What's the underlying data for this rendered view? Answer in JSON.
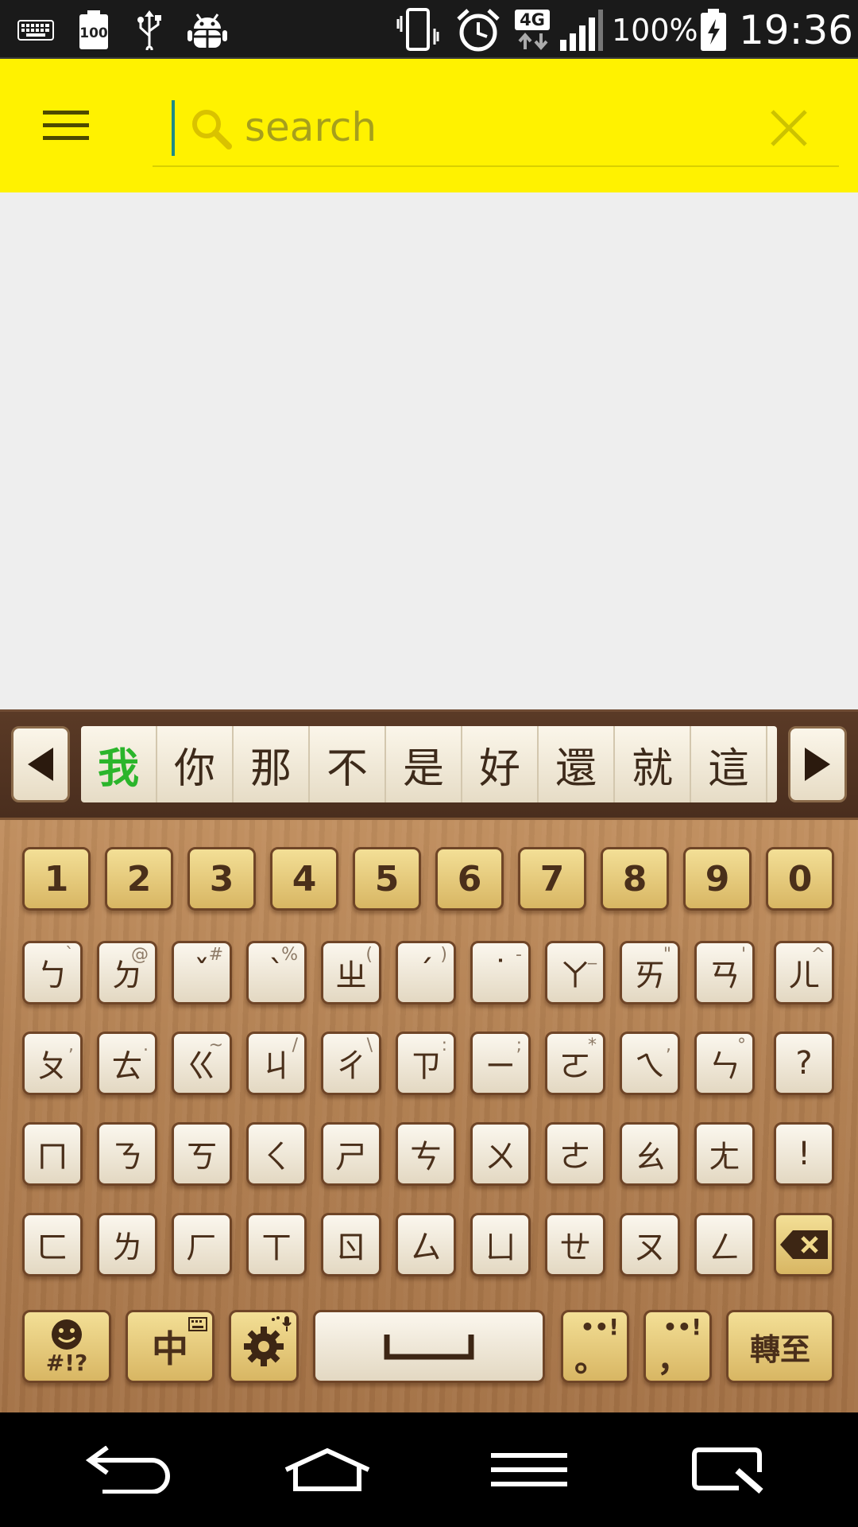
{
  "status_bar": {
    "battery_box_label": "100",
    "network_type": "4G",
    "battery_percent": "100%",
    "time": "19:36",
    "icons": [
      "keyboard-icon",
      "battery-100-icon",
      "usb-icon",
      "android-debug-icon",
      "vibrate-icon",
      "alarm-icon",
      "network-4g-icon",
      "signal-icon",
      "battery-charging-icon"
    ]
  },
  "app_bar": {
    "search_placeholder": "search",
    "search_value": ""
  },
  "candidates": [
    "我",
    "你",
    "那",
    "不",
    "是",
    "好",
    "還",
    "就",
    "這"
  ],
  "keyboard": {
    "number_row": [
      "1",
      "2",
      "3",
      "4",
      "5",
      "6",
      "7",
      "8",
      "9",
      "0"
    ],
    "row1": [
      {
        "main": "ㄅ",
        "sub": "`"
      },
      {
        "main": "ㄉ",
        "sub": "@"
      },
      {
        "main": "ˇ",
        "sub": "#"
      },
      {
        "main": "ˋ",
        "sub": "%"
      },
      {
        "main": "ㄓ",
        "sub": "("
      },
      {
        "main": "ˊ",
        "sub": ")"
      },
      {
        "main": "˙",
        "sub": "-"
      },
      {
        "main": "ㄚ",
        "sub": "_"
      },
      {
        "main": "ㄞ",
        "sub": "\""
      },
      {
        "main": "ㄢ",
        "sub": "'"
      },
      {
        "main": "ㄦ",
        "sub": "^"
      }
    ],
    "row2": [
      {
        "main": "ㄆ",
        "sub": ","
      },
      {
        "main": "ㄊ",
        "sub": "."
      },
      {
        "main": "ㄍ",
        "sub": "~"
      },
      {
        "main": "ㄐ",
        "sub": "/"
      },
      {
        "main": "ㄔ",
        "sub": "\\"
      },
      {
        "main": "ㄗ",
        "sub": ":"
      },
      {
        "main": "ㄧ",
        "sub": ";"
      },
      {
        "main": "ㄛ",
        "sub": "*"
      },
      {
        "main": "ㄟ",
        "sub": ","
      },
      {
        "main": "ㄣ",
        "sub": "°"
      },
      {
        "main": "?",
        "sub": ""
      }
    ],
    "row3": [
      "ㄇ",
      "ㄋ",
      "ㄎ",
      "ㄑ",
      "ㄕ",
      "ㄘ",
      "ㄨ",
      "ㄜ",
      "ㄠ",
      "ㄤ",
      "!"
    ],
    "row4": [
      "ㄈ",
      "ㄌ",
      "ㄏ",
      "ㄒ",
      "ㄖ",
      "ㄙ",
      "ㄩ",
      "ㄝ",
      "ㄡ",
      "ㄥ"
    ],
    "emoji_key_label": "#!?",
    "language_key_label": "中",
    "period_key_label": "。",
    "comma_key_label": "，",
    "enter_key_label": "轉至"
  },
  "colors": {
    "app_bar": "#fff200",
    "content_bg": "#eeeeee",
    "candidate_highlight": "#2bb52b",
    "key_text": "#4a2f1a"
  }
}
